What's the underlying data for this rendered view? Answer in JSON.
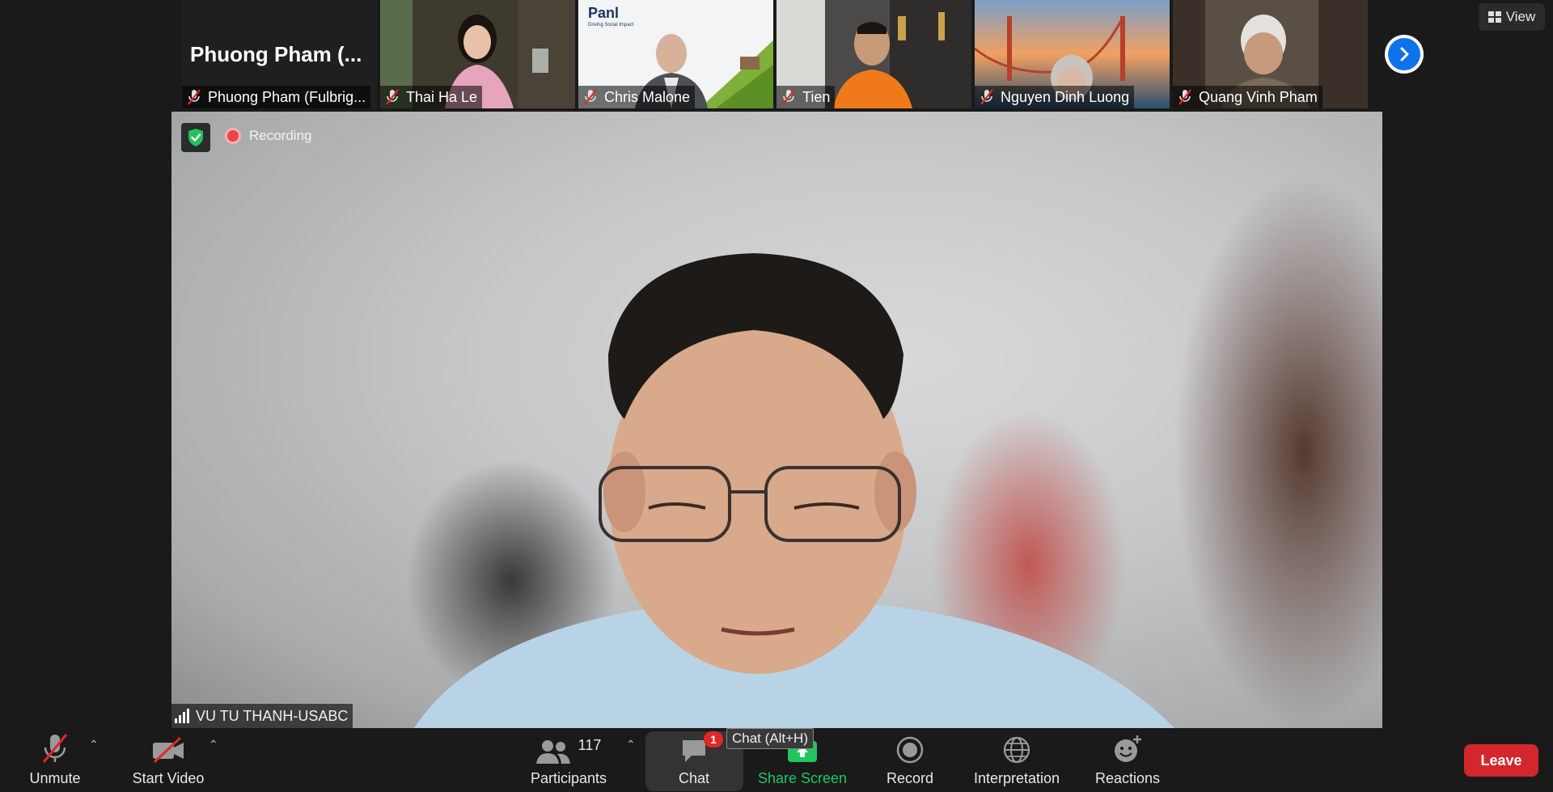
{
  "gallery": {
    "tiles": [
      {
        "big_name": "Phuong Pham (...",
        "name": "Phuong Pham (Fulbrig..."
      },
      {
        "name": "Thai Ha Le"
      },
      {
        "name": "Chris Malone",
        "slide_title": "Panl",
        "slide_subtitle": "Driving Social Impact"
      },
      {
        "name": "Tien"
      },
      {
        "name": "Nguyen Dinh Luong"
      },
      {
        "name": "Quang Vinh Pham"
      }
    ]
  },
  "view_button": {
    "label": "View"
  },
  "main_video": {
    "recording_label": "Recording",
    "speaker_name": "VU TU THANH-USABC"
  },
  "toolbar": {
    "unmute": "Unmute",
    "start_video": "Start Video",
    "participants": "Participants",
    "participants_count": "117",
    "chat": "Chat",
    "chat_badge": "1",
    "chat_tooltip": "Chat (Alt+H)",
    "share_screen": "Share Screen",
    "record": "Record",
    "interpretation": "Interpretation",
    "reactions": "Reactions",
    "leave": "Leave"
  },
  "colors": {
    "accent_blue": "#0e72ed",
    "leave_red": "#d3262d",
    "share_green": "#22c55e",
    "recording_red": "#e8454a"
  }
}
